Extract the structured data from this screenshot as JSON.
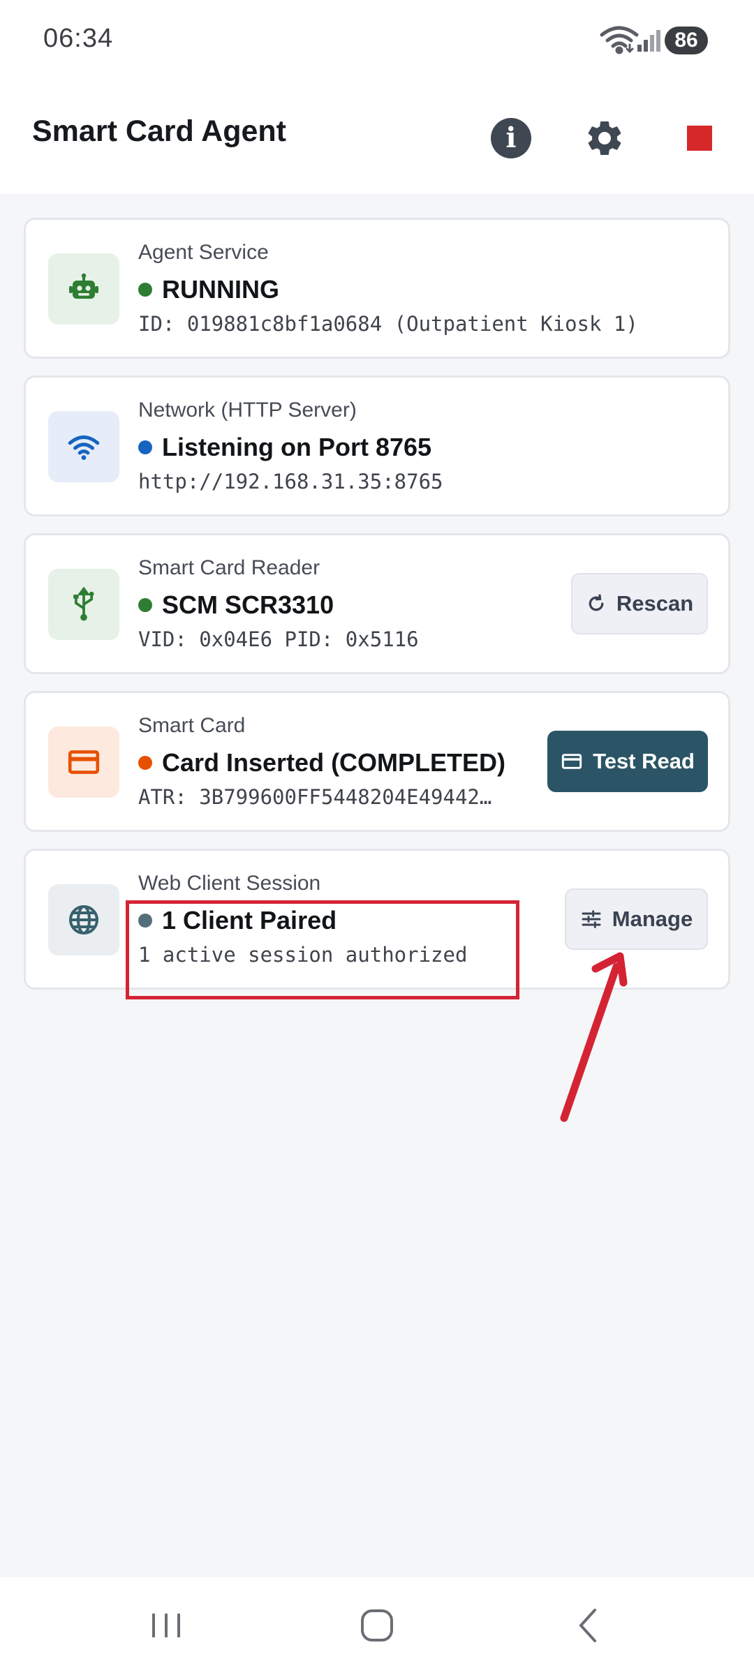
{
  "status_bar": {
    "time": "06:34",
    "battery": "86"
  },
  "app_bar": {
    "title": "Smart Card Agent"
  },
  "cards": [
    {
      "label": "Agent Service",
      "status": "RUNNING",
      "detail": "ID: 019881c8bf1a0684 (Outpatient Kiosk 1)",
      "dot_color": "#2e7d32",
      "icon": "robot-icon"
    },
    {
      "label": "Network (HTTP Server)",
      "status": "Listening on Port 8765",
      "detail": "http://192.168.31.35:8765",
      "dot_color": "#1565c0",
      "icon": "wifi-icon"
    },
    {
      "label": "Smart Card Reader",
      "status": "SCM SCR3310",
      "detail": "VID: 0x04E6 PID: 0x5116",
      "dot_color": "#2e7d32",
      "icon": "usb-icon",
      "action": "Rescan"
    },
    {
      "label": "Smart Card",
      "status": "Card Inserted (COMPLETED)",
      "detail": "ATR: 3B799600FF5448204E49442…",
      "dot_color": "#e65100",
      "icon": "credit-card-icon",
      "action": "Test Read"
    },
    {
      "label": "Web Client Session",
      "status": "1 Client Paired",
      "detail": "1 active session authorized",
      "dot_color": "#546e7a",
      "icon": "globe-icon",
      "action": "Manage"
    }
  ],
  "colors": {
    "accent_dark": "#2b5566",
    "annotation_red": "#d42434",
    "stop_red": "#d62828"
  }
}
